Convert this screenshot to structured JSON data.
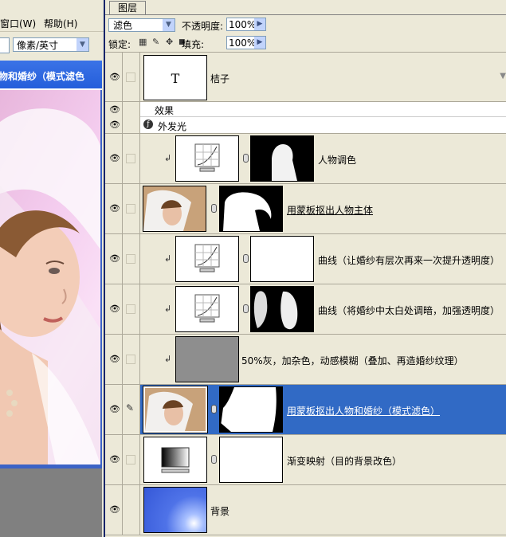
{
  "left_window": {
    "menu": {
      "window": "窗口(W)",
      "help": "帮助(H)"
    },
    "unit_select": "像素/英寸",
    "doc_title": "物和婚纱（模式滤色"
  },
  "panel": {
    "tab": "图层",
    "blend_mode": "滤色",
    "opacity_label": "不透明度:",
    "opacity_value": "100%",
    "lock_label": "锁定:",
    "fill_label": "填充:",
    "fill_value": "100%",
    "type_glyph": "T",
    "effects_label": "效果",
    "outer_glow_label": "外发光"
  },
  "layers": [
    {
      "name": "桔子",
      "kind": "text"
    },
    {
      "name": "人物调色",
      "kind": "curves-clipped"
    },
    {
      "name": "用蒙板抠出人物主体",
      "kind": "photo-mask"
    },
    {
      "name": "曲线（让婚纱有层次再来一次提升透明度）",
      "kind": "curves-clipped"
    },
    {
      "name": "曲线（将婚纱中太白处调暗，加强透明度）",
      "kind": "curves-clipped"
    },
    {
      "name": "50%灰，加杂色，动感模糊（叠加、再造婚纱纹理）",
      "kind": "gray-clipped"
    },
    {
      "name": "用蒙板抠出人物和婚纱（模式滤色）",
      "kind": "photo-mask",
      "selected": true
    },
    {
      "name": "渐变映射（目的背景改色）",
      "kind": "gradient-map"
    },
    {
      "name": "背景",
      "kind": "background"
    }
  ],
  "colors": {
    "selection": "#316ac5",
    "panel_bg": "#ece9d8",
    "titlebar": "#245edb"
  }
}
